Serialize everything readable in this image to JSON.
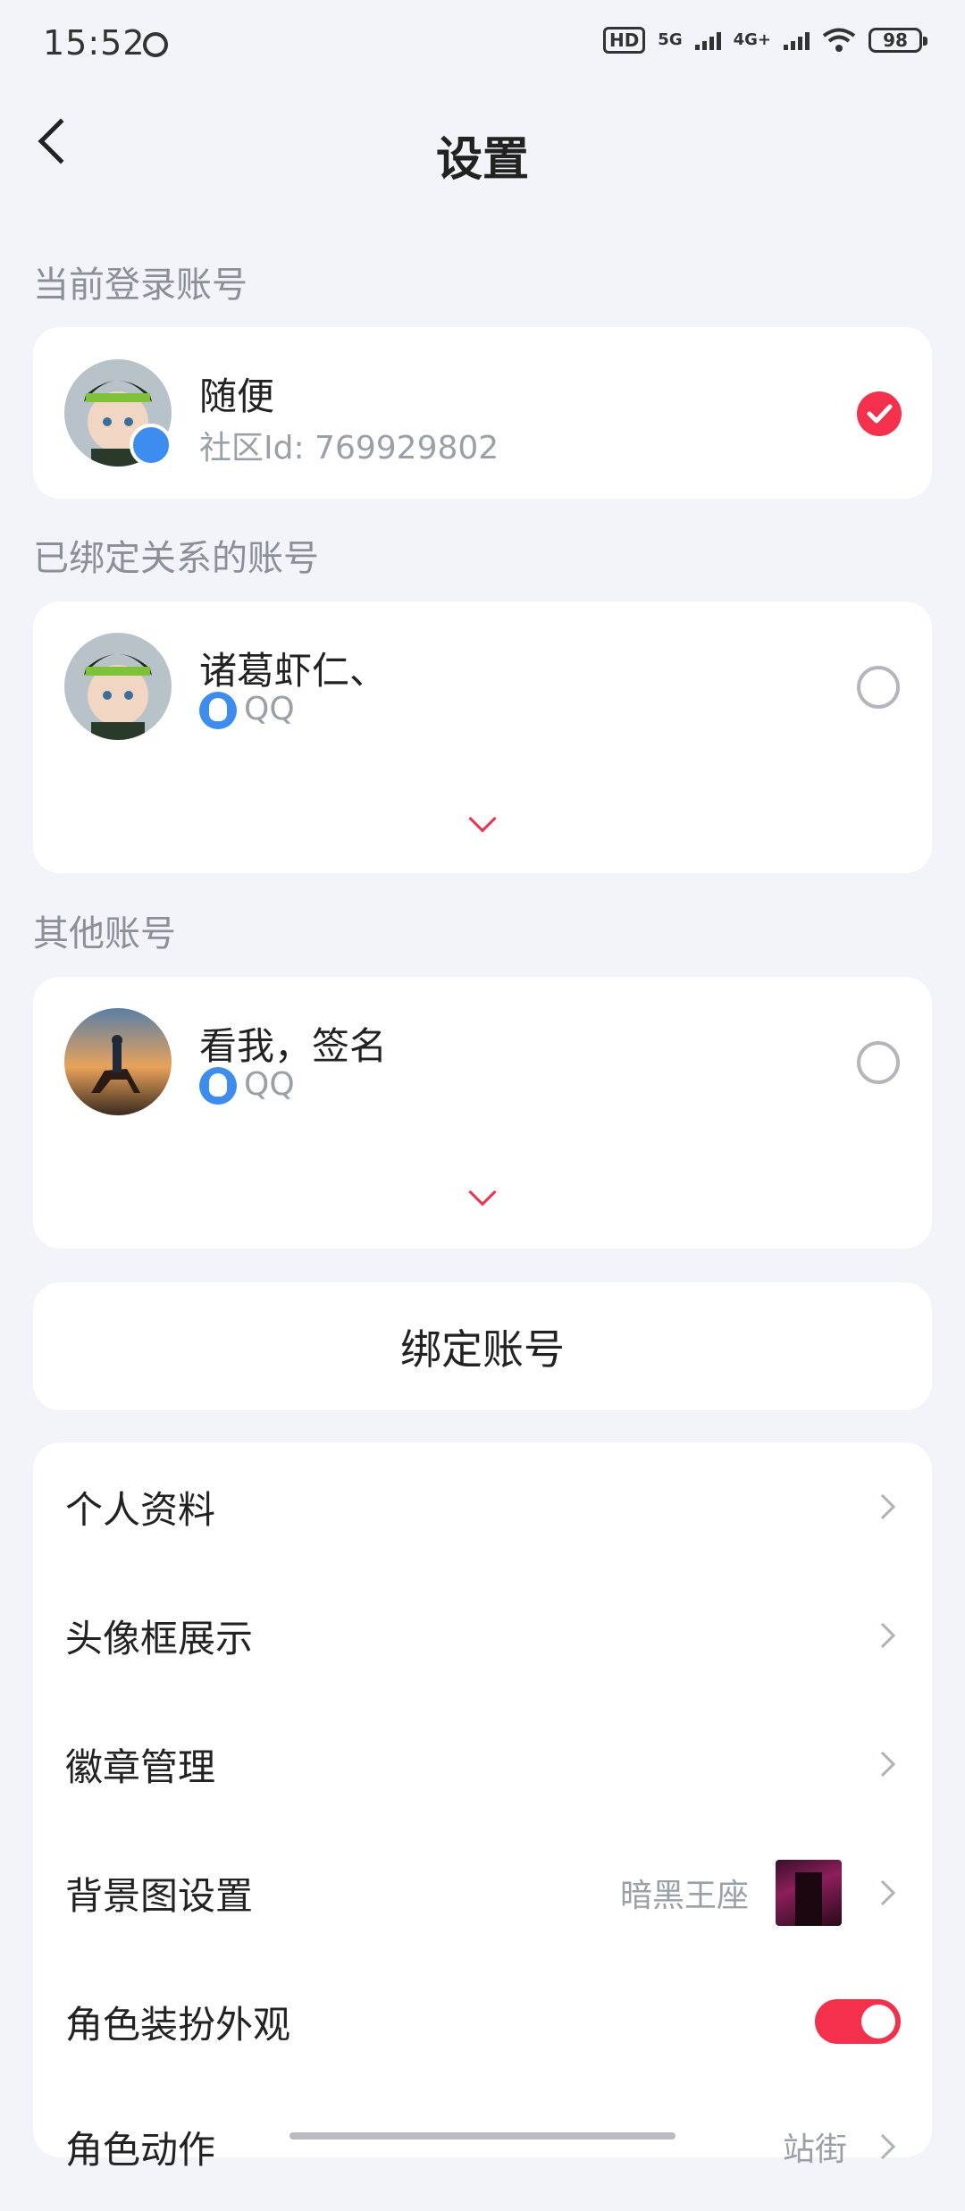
{
  "status_bar": {
    "time": "15:52",
    "hd": "HD",
    "net1": "5G",
    "net2": "4G+",
    "battery": "98"
  },
  "header": {
    "title": "设置"
  },
  "current_account": {
    "section_label": "当前登录账号",
    "name": "随便",
    "community_id": "社区Id: 769929802",
    "selected": true
  },
  "bound_accounts": {
    "section_label": "已绑定关系的账号",
    "items": [
      {
        "name": "诸葛虾仁、",
        "platform": "QQ",
        "selected": false
      }
    ]
  },
  "other_accounts": {
    "section_label": "其他账号",
    "items": [
      {
        "name": "看我，签名",
        "platform": "QQ",
        "selected": false
      }
    ]
  },
  "bind_button": {
    "label": "绑定账号"
  },
  "menu": {
    "items": [
      {
        "label": "个人资料"
      },
      {
        "label": "头像框展示"
      },
      {
        "label": "徽章管理"
      },
      {
        "label": "背景图设置",
        "value": "暗黑王座"
      },
      {
        "label": "角色装扮外观",
        "toggle_on": true
      },
      {
        "label": "角色动作",
        "value": "站街"
      }
    ]
  },
  "colors": {
    "accent": "#f4304d",
    "qq_blue": "#3d8cf0",
    "background": "#f2f4f9"
  }
}
